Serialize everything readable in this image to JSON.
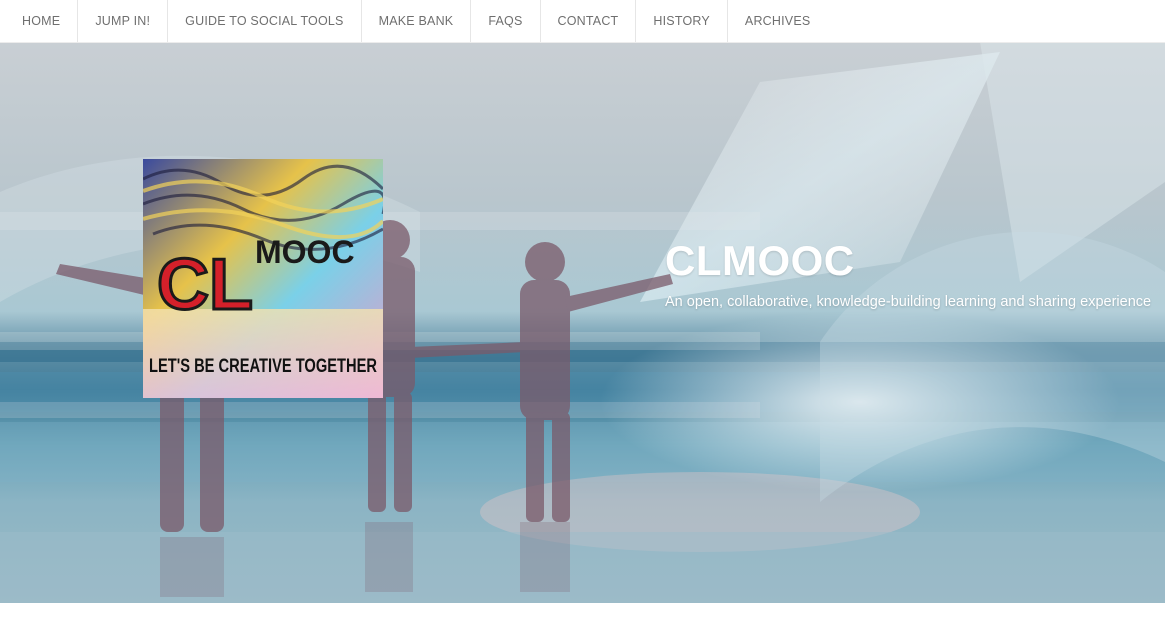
{
  "nav": {
    "items": [
      {
        "label": "HOME"
      },
      {
        "label": "JUMP IN!"
      },
      {
        "label": "GUIDE TO SOCIAL TOOLS"
      },
      {
        "label": "MAKE BANK"
      },
      {
        "label": "FAQS"
      },
      {
        "label": "CONTACT"
      },
      {
        "label": "HISTORY"
      },
      {
        "label": "ARCHIVES"
      }
    ]
  },
  "header": {
    "site_title": "CLMOOC",
    "tagline": "An open, collaborative, knowledge-building learning and sharing experience"
  },
  "logo": {
    "letters": "CL",
    "mooc": "MOOC",
    "caption": "LET'S BE CREATIVE TOGETHER"
  },
  "colors": {
    "nav_text": "#6f6f6f",
    "title_text": "#ffffff",
    "sea": "#3f7b98",
    "sky": "#c9cfd4"
  }
}
